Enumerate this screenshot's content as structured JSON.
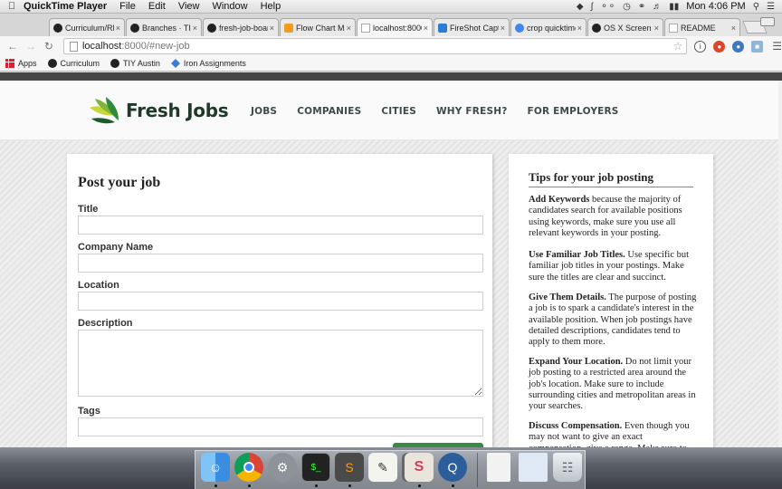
{
  "menubar": {
    "app_name": "QuickTime Player",
    "items": [
      "File",
      "Edit",
      "View",
      "Window",
      "Help"
    ],
    "clock": "Mon 4:06 PM"
  },
  "tabs": [
    {
      "label": "Curriculum/RE",
      "color": "#222222"
    },
    {
      "label": "Branches · TI",
      "color": "#222222"
    },
    {
      "label": "fresh-job-boar",
      "color": "#222222"
    },
    {
      "label": "Flow Chart Ma",
      "color": "#f39c1f"
    },
    {
      "label": "localhost:8000",
      "color": "#cccccc"
    },
    {
      "label": "FireShot Capt",
      "color": "#2b7bd8"
    },
    {
      "label": "crop quicktime",
      "color": "#4285f4"
    },
    {
      "label": "OS X Screen",
      "color": "#222222"
    },
    {
      "label": "README",
      "color": "#cccccc"
    }
  ],
  "address": {
    "host": "localhost",
    "path": ":8000/#new-job"
  },
  "bookmarks": [
    "Apps",
    "Curriculum",
    "TIY Austin",
    "Iron Assignments"
  ],
  "site": {
    "logo": "Fresh Jobs",
    "nav": [
      "JOBS",
      "COMPANIES",
      "CITIES",
      "WHY FRESH?",
      "FOR EMPLOYERS"
    ]
  },
  "form": {
    "title": "Post your job",
    "fields": {
      "title": "Title",
      "company": "Company Name",
      "location": "Location",
      "description": "Description",
      "tags": "Tags"
    }
  },
  "tips": {
    "heading": "Tips for your job posting",
    "items": [
      {
        "bold": "Add Keywords",
        "text": " because the majority of candidates search for available positions using keywords, make sure you use all relevant keywords in your posting."
      },
      {
        "bold": "Use Familiar Job Titles.",
        "text": " Use specific but familiar job titles in your postings. Make sure the titles are clear and succinct."
      },
      {
        "bold": "Give Them Details.",
        "text": " The purpose of posting a job is to spark a candidate's interest in the available position. When job postings have detailed descriptions, candidates tend to apply to them more."
      },
      {
        "bold": "Expand Your Location.",
        "text": " Do not limit your job posting to a restricted area around the job's location. Make sure to include surrounding cities and metropolitan areas in your searches."
      },
      {
        "bold": "Discuss Compensation.",
        "text": " Even though you may not want to give an exact compensation, give a range. Make sure to"
      }
    ]
  },
  "dock": [
    "finder-icon",
    "chrome-icon",
    "system-preferences-icon",
    "terminal-icon",
    "sublime-text-icon",
    "text-edit-icon",
    "quill-icon",
    "slack-icon",
    "quicktime-icon",
    "document-icon",
    "preview-icon",
    "trash-icon"
  ]
}
